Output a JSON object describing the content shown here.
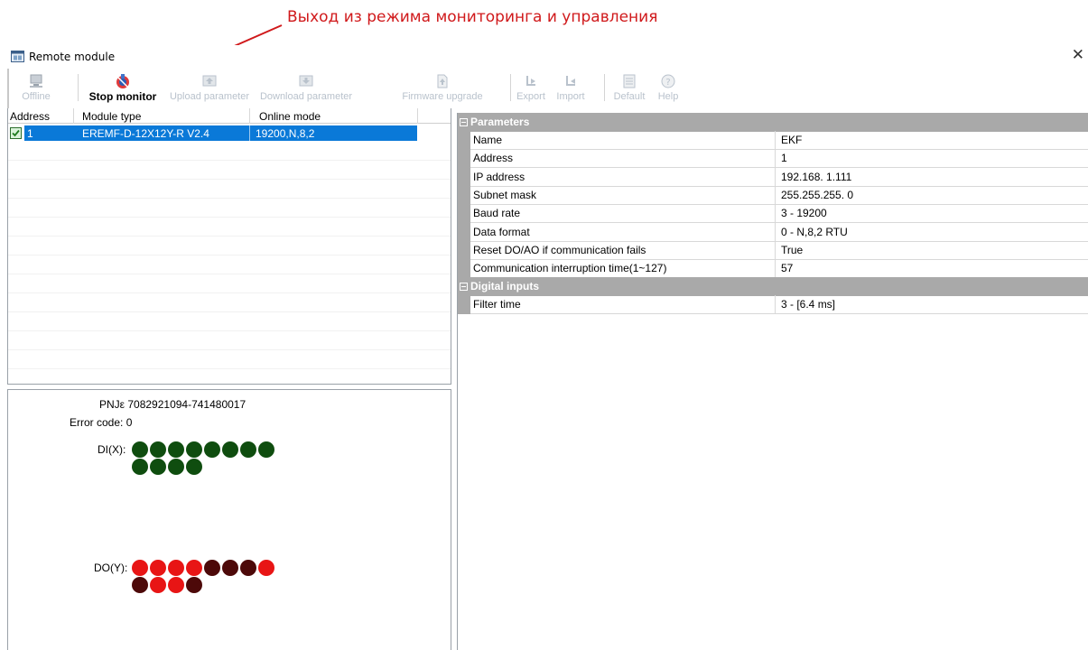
{
  "annotation": {
    "text": "Выход из режима мониторинга и управления",
    "color": "#d0191b"
  },
  "window": {
    "title": "Remote module",
    "close_glyph": "✕"
  },
  "toolbar": {
    "buttons": [
      {
        "label": "Offline",
        "icon": "offline-icon",
        "enabled": false
      },
      {
        "label": "Stop monitor",
        "icon": "stop-monitor-icon",
        "enabled": true
      },
      {
        "label": "Upload parameter",
        "icon": "upload-icon",
        "enabled": false
      },
      {
        "label": "Download parameter",
        "icon": "download-icon",
        "enabled": false
      },
      {
        "label": "Firmware upgrade",
        "icon": "firmware-icon",
        "enabled": false
      },
      {
        "label": "Export",
        "icon": "export-icon",
        "enabled": false
      },
      {
        "label": "Import",
        "icon": "import-icon",
        "enabled": false
      },
      {
        "label": "Default",
        "icon": "default-icon",
        "enabled": false
      },
      {
        "label": "Help",
        "icon": "help-icon",
        "enabled": false
      }
    ]
  },
  "module_list": {
    "columns": [
      "Address",
      "Module type",
      "Online mode"
    ],
    "rows": [
      {
        "address": "1",
        "module_type": "EREMF-D-12X12Y-R V2.4",
        "online_mode": "19200,N,8,2",
        "checked": true,
        "selected": true
      }
    ],
    "selection_color": "#0a79d8"
  },
  "status": {
    "pn": "PNJε 7082921094-741480017",
    "error_code": "Error code: 0",
    "di_label": "DI(X):",
    "do_label": "DO(Y):",
    "di_states": [
      1,
      1,
      1,
      1,
      1,
      1,
      1,
      1,
      1,
      1,
      1,
      1
    ],
    "do_states": [
      1,
      1,
      1,
      1,
      0,
      0,
      0,
      1,
      0,
      1,
      1,
      0
    ],
    "colors": {
      "di_on": "#0f4d0f",
      "do_on": "#e81515",
      "do_off": "#4d0909"
    }
  },
  "properties": {
    "categories": [
      {
        "name": "Parameters",
        "rows": [
          {
            "name": "Name",
            "value": "EKF"
          },
          {
            "name": "Address",
            "value": "1"
          },
          {
            "name": "IP address",
            "value": "192.168.  1.111"
          },
          {
            "name": "Subnet mask",
            "value": "255.255.255.  0"
          },
          {
            "name": "Baud rate",
            "value": "3 - 19200"
          },
          {
            "name": "Data format",
            "value": "0 - N,8,2 RTU"
          },
          {
            "name": "Reset DO/AO if communication fails",
            "value": "True"
          },
          {
            "name": "Communication interruption time(1~127)",
            "value": "57"
          }
        ]
      },
      {
        "name": "Digital inputs",
        "rows": [
          {
            "name": "Filter time",
            "value": "3 - [6.4 ms]"
          }
        ]
      }
    ],
    "category_color": "#a9a9a9"
  }
}
